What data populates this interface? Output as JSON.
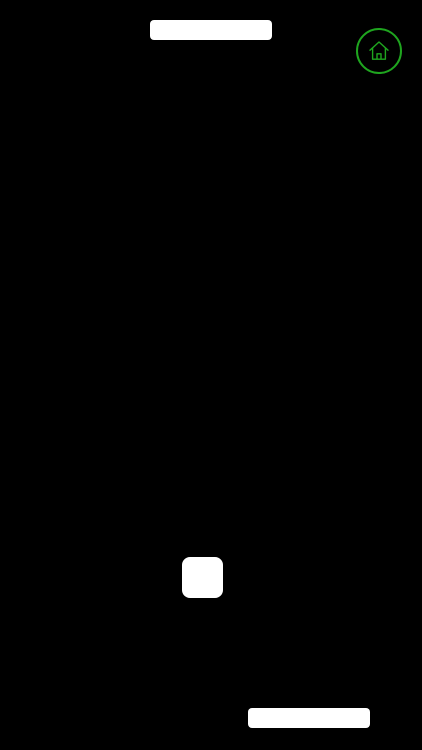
{
  "screen": {
    "background_color": "#000000"
  },
  "paddles": {
    "top": {
      "color": "#ffffff"
    },
    "bottom": {
      "color": "#ffffff"
    }
  },
  "ball": {
    "color": "#ffffff"
  },
  "home_button": {
    "icon": "home-icon",
    "accent_color": "#1fa51f"
  }
}
